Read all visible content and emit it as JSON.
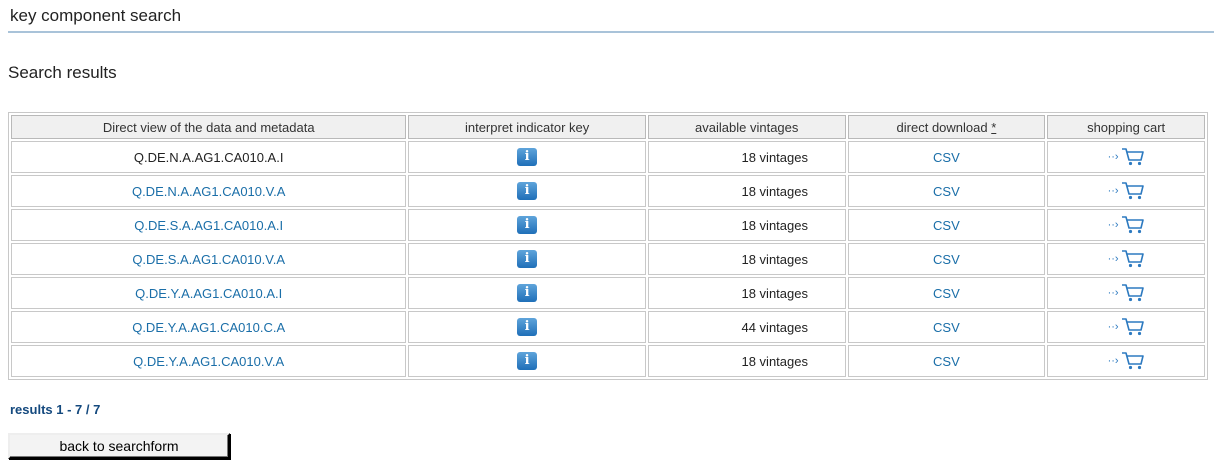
{
  "page": {
    "title": "key component search",
    "section_title": "Search results"
  },
  "table": {
    "headers": {
      "series": "Direct view of the data and metadata",
      "indicator": "interpret indicator key",
      "vintages": "available vintages",
      "download": "direct download",
      "download_footnote": "*",
      "cart": "shopping cart"
    },
    "rows": [
      {
        "key": "Q.DE.N.A.AG1.CA010.A.I",
        "vintages": "18 vintages",
        "download": "CSV",
        "linked": false
      },
      {
        "key": "Q.DE.N.A.AG1.CA010.V.A",
        "vintages": "18 vintages",
        "download": "CSV",
        "linked": true
      },
      {
        "key": "Q.DE.S.A.AG1.CA010.A.I",
        "vintages": "18 vintages",
        "download": "CSV",
        "linked": true
      },
      {
        "key": "Q.DE.S.A.AG1.CA010.V.A",
        "vintages": "18 vintages",
        "download": "CSV",
        "linked": true
      },
      {
        "key": "Q.DE.Y.A.AG1.CA010.A.I",
        "vintages": "18 vintages",
        "download": "CSV",
        "linked": true
      },
      {
        "key": "Q.DE.Y.A.AG1.CA010.C.A",
        "vintages": "44 vintages",
        "download": "CSV",
        "linked": true
      },
      {
        "key": "Q.DE.Y.A.AG1.CA010.V.A",
        "vintages": "18 vintages",
        "download": "CSV",
        "linked": true
      }
    ],
    "icons": {
      "indicator": "info-icon",
      "cart_arrow": "arrow-icon",
      "cart": "shopping-cart-icon",
      "info_glyph": "i",
      "arrow_glyph": "··›"
    }
  },
  "pager": {
    "label": "results 1 - 7 / 7"
  },
  "buttons": {
    "back": "back to searchform"
  },
  "colors": {
    "link": "#1a6ea8",
    "rule": "#a9c3d9",
    "pager": "#14497e",
    "icon_blue": "#2d7ac0"
  }
}
